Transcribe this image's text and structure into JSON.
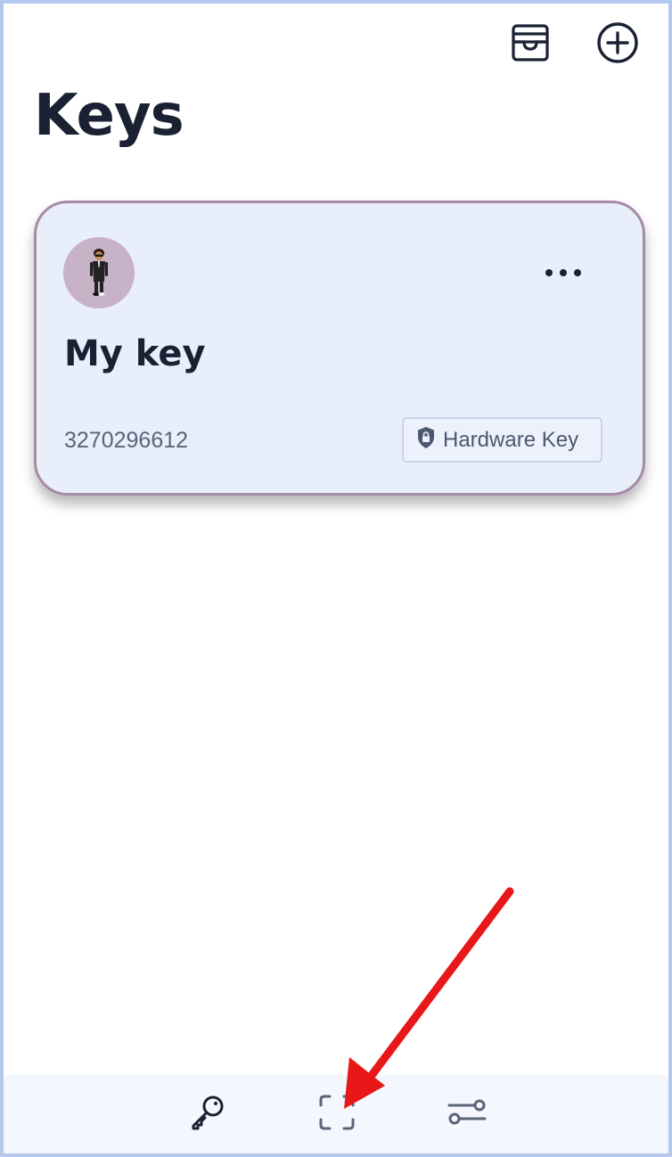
{
  "page": {
    "title": "Keys"
  },
  "header": {
    "wallet_icon": "wallet-icon",
    "add_icon": "plus-circle-icon"
  },
  "key_card": {
    "name": "My key",
    "id": "3270296612",
    "badge_label": "Hardware Key",
    "badge_icon": "shield-lock-icon",
    "avatar_icon": "person-emoji-avatar",
    "menu_icon": "more-horizontal-icon"
  },
  "bottom_nav": {
    "items": [
      {
        "icon": "key-icon"
      },
      {
        "icon": "scan-icon"
      },
      {
        "icon": "settings-sliders-icon"
      }
    ]
  },
  "annotation": {
    "color": "#e81818",
    "target": "scan-icon"
  },
  "colors": {
    "card_bg": "#e8eefa",
    "card_border": "#a68ba6",
    "avatar_bg": "#c7b2c8",
    "frame_border": "#b4c8ee",
    "text_dark": "#1a2133"
  }
}
